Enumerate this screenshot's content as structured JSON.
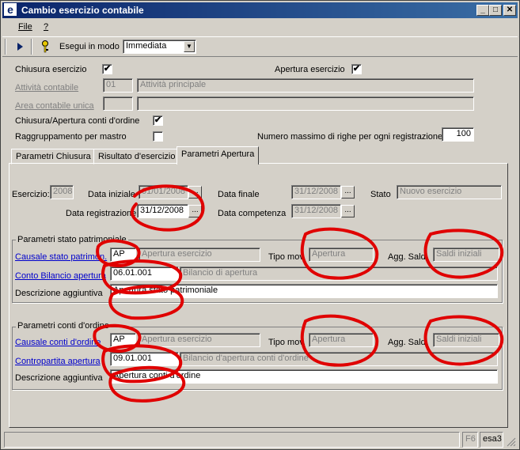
{
  "window": {
    "title": "Cambio esercizio contabile",
    "app_icon": "e",
    "min": "_",
    "max": "□",
    "close": "✕"
  },
  "menu": {
    "file": "File",
    "help": "?"
  },
  "toolbar": {
    "run_mode_label": "Esegui in modo",
    "run_mode_value": "Immediata",
    "run_icon": "play-icon",
    "key_icon": "key-icon"
  },
  "top": {
    "closing_label": "Chiusura esercizio",
    "closing_checked": "✔",
    "opening_label": "Apertura esercizio",
    "opening_checked": "✔",
    "activity_label": "Attività contabile",
    "activity_code": "01",
    "activity_desc": "Attività principale",
    "area_label": "Area contabile unica",
    "area_code": "",
    "area_desc": "",
    "order_accounts_label": "Chiusura/Apertura conti d'ordine",
    "order_accounts_checked": "✔",
    "group_master_label": "Raggruppamento per mastro",
    "group_master_checked": "",
    "max_rows_label": "Numero massimo di righe per ogni registrazione",
    "max_rows_value": "100"
  },
  "tabs": [
    "Parametri Chiusura",
    "Risultato d'esercizio",
    "Parametri Apertura"
  ],
  "active_tab": "Parametri Apertura",
  "params": {
    "esercizio_label": "Esercizio:",
    "esercizio_value": "2008",
    "data_iniziale_label": "Data iniziale",
    "data_iniziale_value": "01/01/2008",
    "data_finale_label": "Data finale",
    "data_finale_value": "31/12/2008",
    "stato_label": "Stato",
    "stato_value": "Nuovo esercizio",
    "data_reg_label": "Data registrazione",
    "data_reg_value": "31/12/2008",
    "data_comp_label": "Data competenza",
    "data_comp_value": "31/12/2008",
    "dots": "..."
  },
  "group1": {
    "title": "Parametri stato patrimoniale",
    "causale_label": "Causale stato patrimon.",
    "causale_code": "AP",
    "causale_desc": "Apertura esercizio",
    "tipo_label": "Tipo mov.",
    "tipo_value": "Apertura",
    "agg_label": "Agg. Saldi",
    "agg_value": "Saldi iniziali",
    "conto_label": "Conto Bilancio apertura",
    "conto_code": "06.01.001",
    "conto_desc": "Bilancio di apertura",
    "descr_label": "Descrizione aggiuntiva",
    "descr_value": "Apertura stato patrimoniale"
  },
  "group2": {
    "title": "Parametri conti d'ordine",
    "causale_label": "Causale conti d'ordine",
    "causale_code": "AP",
    "causale_desc": "Apertura esercizio",
    "tipo_label": "Tipo mov.",
    "tipo_value": "Apertura",
    "agg_label": "Agg. Saldi",
    "agg_value": "Saldi iniziali",
    "conto_label": "Contropartita apertura",
    "conto_code": "09.01.001",
    "conto_desc": "Bilancio d'apertura conti d'ordine",
    "descr_label": "Descrizione aggiuntiva",
    "descr_value": "Apertura conti d'ordine"
  },
  "statusbar": {
    "main": "",
    "key": "F6",
    "user": "esa3"
  },
  "colors": {
    "title_bar": "#0a246a",
    "annotation": "#e00000",
    "link": "#0000cc"
  }
}
